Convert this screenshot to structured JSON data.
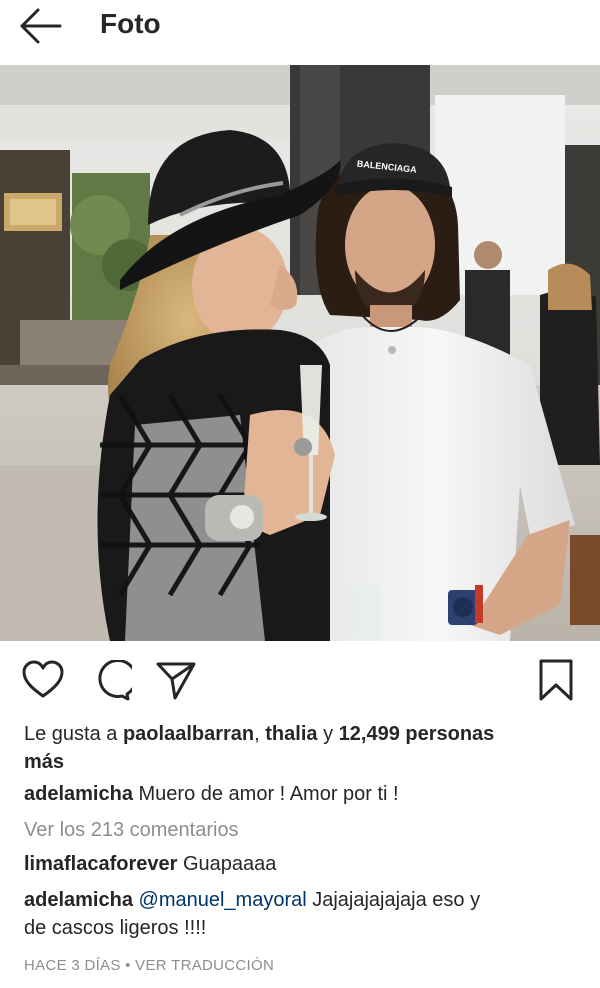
{
  "header": {
    "title": "Foto",
    "back_icon": "arrow-left-icon"
  },
  "photo": {
    "hat_text": "BALENCIAGA"
  },
  "actions": {
    "like_icon": "heart-icon",
    "comment_icon": "comment-icon",
    "share_icon": "send-icon",
    "save_icon": "bookmark-icon"
  },
  "likes": {
    "prefix": "Le gusta a ",
    "user1": "paolaalbarran",
    "sep": ", ",
    "user2": "thalia",
    "and": " y ",
    "count": "12,499 personas",
    "suffix": "más"
  },
  "caption": {
    "user": "adelamicha",
    "text": " Muero de amor ! Amor por ti !"
  },
  "view_comments": "Ver los 213 comentarios",
  "comments": [
    {
      "user": "limaflacaforever",
      "text": " Guapaaaa"
    },
    {
      "user": "adelamicha",
      "mention": "@manuel_mayoral",
      "text": " Jajajajajajaja eso y",
      "text2": "de cascos ligeros !!!!"
    }
  ],
  "footer": {
    "time": "HACE 3 DÍAS",
    "dot": " • ",
    "translate": "VER TRADUCCIÓN"
  }
}
